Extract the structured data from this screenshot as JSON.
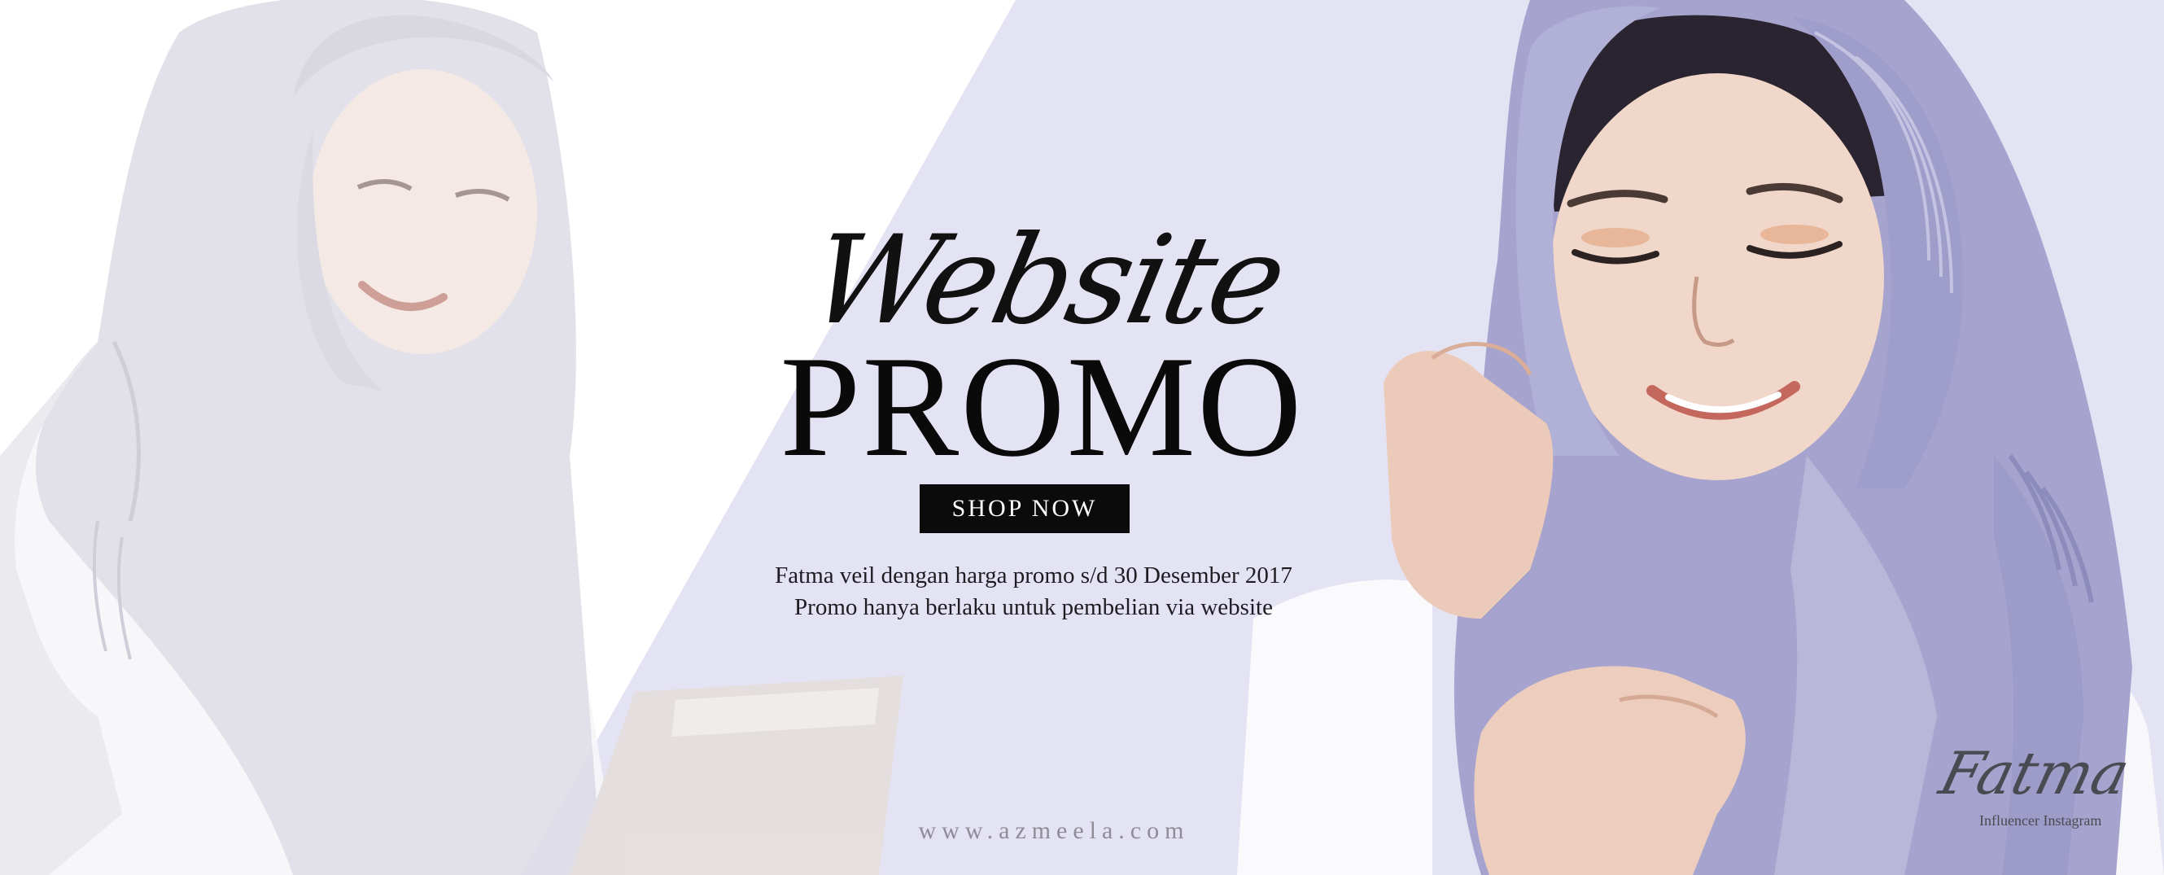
{
  "banner": {
    "script_title": "Website",
    "main_title": "PROMO",
    "shop_button_label": "SHOP NOW",
    "description_lines": [
      "Fatma veil dengan harga promo s/d 30 Desember 2017",
      "Promo hanya berlaku untuk pembelian via website"
    ],
    "website_url": "www.azmeela.com",
    "signature": {
      "name": "Fatma",
      "caption": "Influencer Instagram"
    }
  },
  "images": {
    "left_model": "woman-in-light-grey-hijab-holding-tablet",
    "right_model": "woman-in-lavender-hijab-smiling"
  },
  "colors": {
    "background_white": "#ffffff",
    "background_lavender": "#e4e3f4",
    "button_background": "#0b0b0b",
    "button_text": "#ffffff",
    "title_text": "#0a0a0a",
    "hijab_lavender": "#a8a7cf",
    "url_text": "#8e8d96"
  }
}
